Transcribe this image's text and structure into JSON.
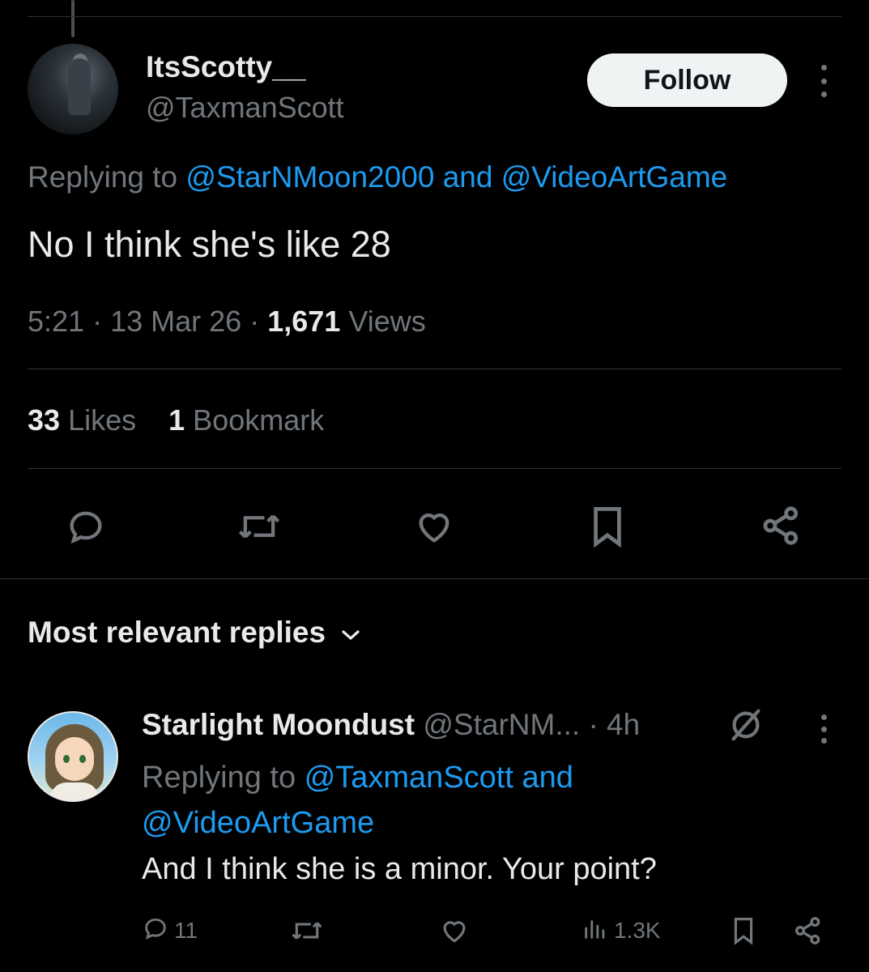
{
  "tweet": {
    "author_name": "ItsScotty__",
    "author_handle": "@TaxmanScott",
    "follow_label": "Follow",
    "replying_prefix": "Replying to",
    "replying_user1": "@StarNMoon2000",
    "replying_and": "and",
    "replying_user2": "@VideoArtGame",
    "text": "No I think she's like 28",
    "time": "5:21",
    "sep": "·",
    "date": "13 Mar 26",
    "views_count": "1,671",
    "views_label": "Views",
    "likes_count": "33",
    "likes_label": "Likes",
    "bookmarks_count": "1",
    "bookmarks_label": "Bookmark"
  },
  "replies_header": {
    "label": "Most relevant replies"
  },
  "reply": {
    "author_name": "Starlight Moondust",
    "author_handle": "@StarNM...",
    "age": "· 4h",
    "replying_prefix": "Replying to",
    "replying_user1": "@TaxmanScott",
    "replying_and": "and",
    "replying_user2": "@VideoArtGame",
    "text": "And I think she is a minor. Your point?",
    "reply_count": "11",
    "views_count": "1.3K"
  },
  "icons": {
    "reply": "reply-icon",
    "repost": "repost-icon",
    "like": "heart-icon",
    "bookmark": "bookmark-icon",
    "share": "share-icon",
    "views": "views-icon",
    "more": "more-icon",
    "chevron": "chevron-down-icon",
    "verified": "grok-icon"
  },
  "colors": {
    "background": "#000000",
    "text": "#e7e9ea",
    "muted": "#71767b",
    "link": "#1d9bf0",
    "divider": "#2f3336"
  }
}
